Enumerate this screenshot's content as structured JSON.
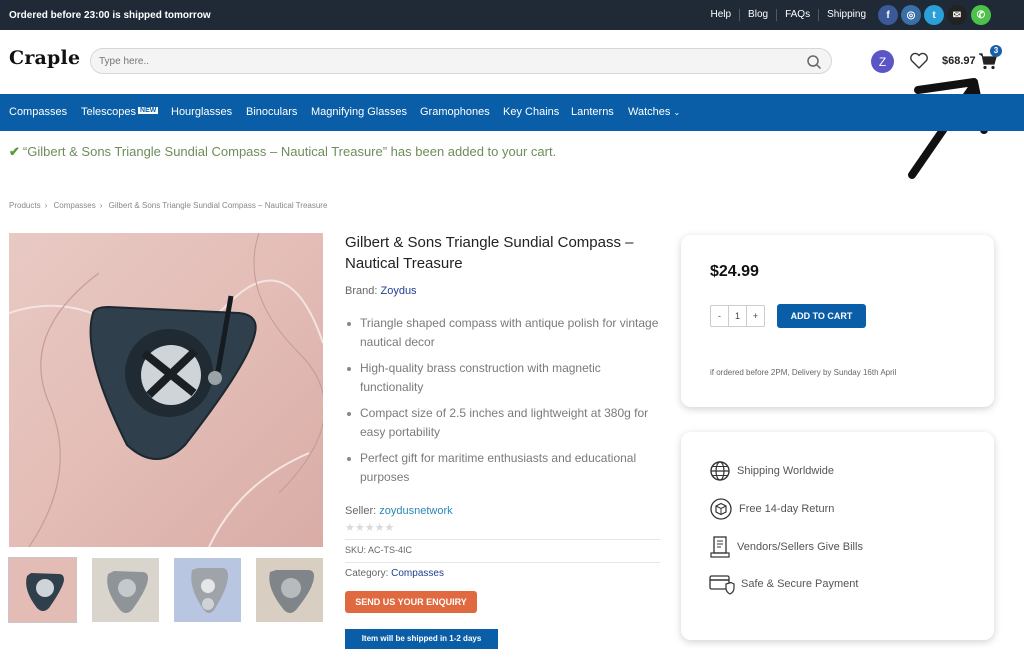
{
  "topbar": {
    "shipping_note": "Ordered before 23:00 is shipped tomorrow",
    "links": [
      "Help",
      "Blog",
      "FAQs",
      "Shipping"
    ],
    "social": [
      {
        "icon": "facebook-icon",
        "glyph": "f",
        "color": "#3b5998"
      },
      {
        "icon": "instagram-icon",
        "glyph": "◎",
        "color": "#3a6fa8"
      },
      {
        "icon": "twitter-icon",
        "glyph": "t",
        "color": "#2a9fd8"
      },
      {
        "icon": "email-icon",
        "glyph": "✉",
        "color": "#222222"
      },
      {
        "icon": "whatsapp-icon",
        "glyph": "✆",
        "color": "#4cc24a"
      }
    ]
  },
  "header": {
    "logo": "Craple",
    "search_placeholder": "Type here..",
    "avatar_letter": "Z",
    "cart_total": "$68.97",
    "cart_count": "3"
  },
  "nav": {
    "items": [
      "Compasses",
      "Telescopes",
      "Hourglasses",
      "Binoculars",
      "Magnifying Glasses",
      "Gramophones",
      "Key Chains",
      "Lanterns",
      "Watches"
    ],
    "new_badge": "NEW"
  },
  "notice": "“Gilbert & Sons Triangle Sundial Compass – Nautical Treasure” has been added to your cart.",
  "breadcrumb": [
    "Products",
    "Compasses",
    "Gilbert & Sons Triangle Sundial Compass – Nautical Treasure"
  ],
  "product": {
    "title": "Gilbert & Sons Triangle Sundial Compass – Nautical Treasure",
    "brand_label": "Brand:",
    "brand": "Zoydus",
    "bullets": [
      "Triangle shaped compass with antique polish for vintage nautical decor",
      "High-quality brass construction with magnetic functionality",
      "Compact size of 2.5 inches and lightweight at 380g for easy portability",
      "Perfect gift for maritime enthusiasts and educational purposes"
    ],
    "seller_label": "Seller:",
    "seller": "zoydusnetwork",
    "rating_stars": "★★★★★",
    "sku": "SKU: AC-TS-4IC",
    "category_label": "Category:",
    "category": "Compasses",
    "enquiry_label": "SEND US YOUR ENQUIRY",
    "ship_badge": "Item will be shipped in 1-2 days"
  },
  "buybox": {
    "price": "$24.99",
    "qty_minus": "-",
    "qty_value": "1",
    "qty_plus": "+",
    "add_to_cart": "ADD TO CART",
    "delivery": "if ordered before 2PM, Delivery by Sunday 16th April"
  },
  "features": [
    {
      "icon": "globe-icon",
      "label": "Shipping Worldwide"
    },
    {
      "icon": "return-box-icon",
      "label": "Free 14-day Return"
    },
    {
      "icon": "invoice-icon",
      "label": "Vendors/Sellers Give Bills"
    },
    {
      "icon": "secure-card-icon",
      "label": "Safe & Secure Payment"
    }
  ]
}
